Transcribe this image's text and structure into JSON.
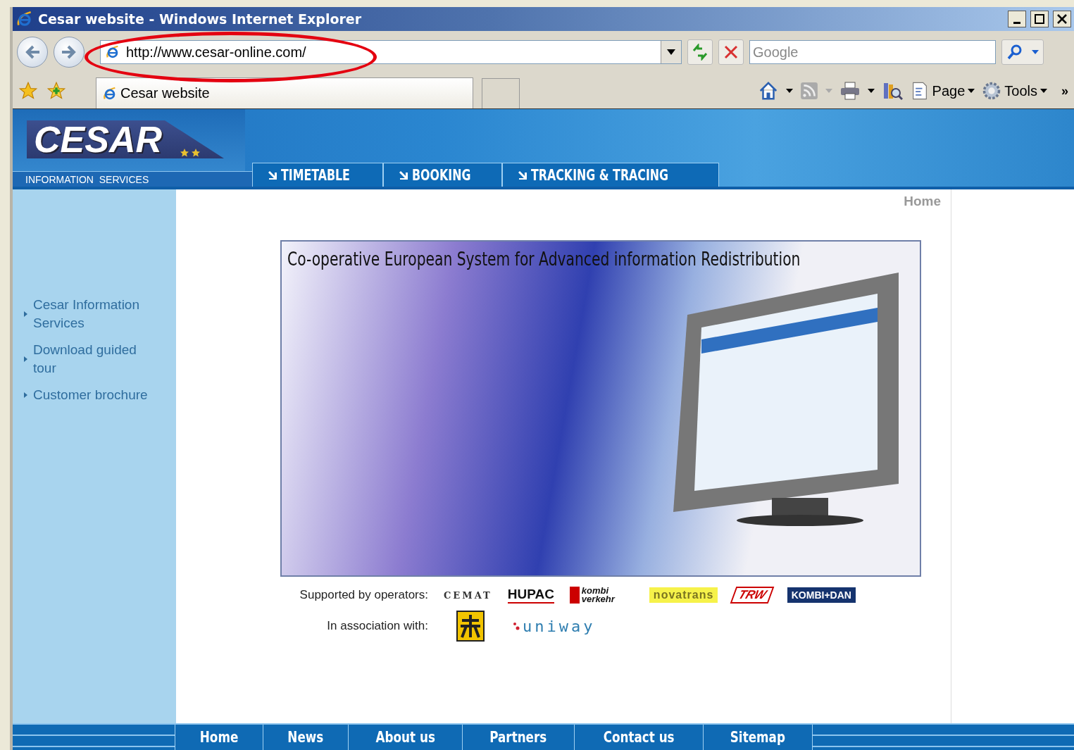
{
  "window": {
    "title": "Cesar website - Windows Internet Explorer"
  },
  "address_bar": {
    "url": "http://www.cesar-online.com/"
  },
  "search": {
    "placeholder": "Google"
  },
  "tabs": [
    {
      "label": "Cesar website",
      "selected": true
    }
  ],
  "command_bar": {
    "page": "Page",
    "tools": "Tools",
    "more": "»"
  },
  "site": {
    "logo": "CESAR",
    "tagline": "INFORMATION  SERVICES",
    "nav": [
      {
        "label": "TIMETABLE"
      },
      {
        "label": "BOOKING"
      },
      {
        "label": "TRACKING & TRACING"
      }
    ],
    "breadcrumb": "Home",
    "sidebar": [
      {
        "label": "Cesar Information Services"
      },
      {
        "label": "Download guided tour"
      },
      {
        "label": "Customer brochure"
      }
    ],
    "banner_title": "Co-operative European System for Advanced information Redistribution",
    "supported_label": "Supported by operators:",
    "operators": [
      {
        "name": "CEMAT",
        "kind": "cemat"
      },
      {
        "name": "HUPAC",
        "kind": "hupac"
      },
      {
        "name": "kombi verkehr",
        "kind": "kombiverkehr"
      },
      {
        "name": "novatrans",
        "kind": "novatrans"
      },
      {
        "name": "TRW",
        "kind": "trw"
      },
      {
        "name": "KOMBI+DAN",
        "kind": "kombidan"
      }
    ],
    "association_label": "In association with:",
    "associations": [
      {
        "kind": "emblem"
      },
      {
        "kind": "wordmark",
        "name": "uniway"
      }
    ],
    "footer_nav": [
      {
        "label": "Home"
      },
      {
        "label": "News"
      },
      {
        "label": "About us"
      },
      {
        "label": "Partners"
      },
      {
        "label": "Contact us"
      },
      {
        "label": "Sitemap"
      }
    ]
  }
}
